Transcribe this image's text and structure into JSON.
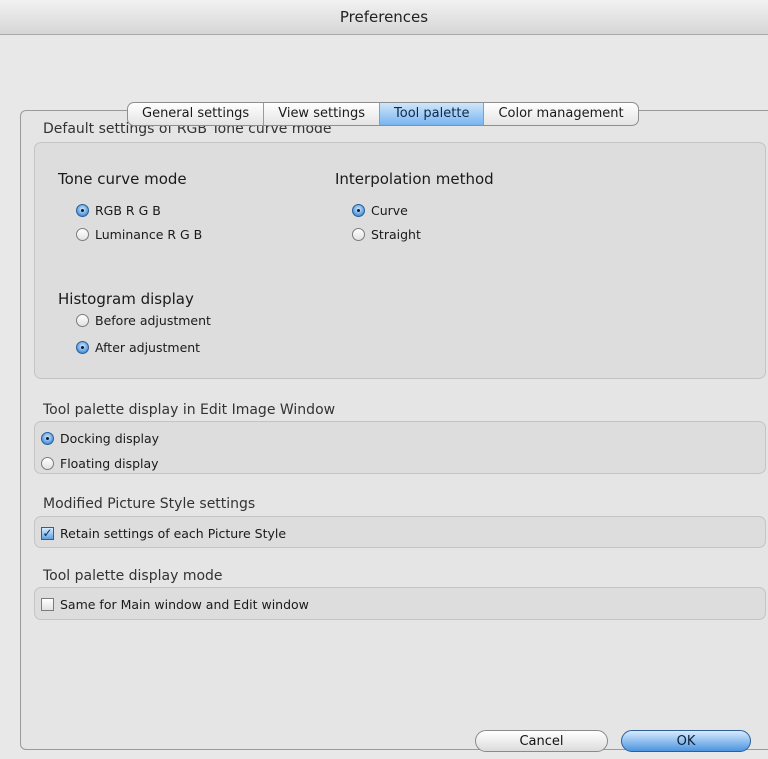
{
  "window": {
    "title": "Preferences"
  },
  "tabs": [
    {
      "label": "General settings",
      "active": false
    },
    {
      "label": "View settings",
      "active": false
    },
    {
      "label": "Tool palette",
      "active": true
    },
    {
      "label": "Color management",
      "active": false
    }
  ],
  "rgb_tone": {
    "title": "Default settings of RGB Tone curve mode",
    "tone_curve_mode": {
      "label": "Tone curve mode",
      "options": [
        {
          "label": "RGB R G B",
          "selected": true
        },
        {
          "label": "Luminance R G B",
          "selected": false
        }
      ]
    },
    "interpolation": {
      "label": "Interpolation method",
      "options": [
        {
          "label": "Curve",
          "selected": true
        },
        {
          "label": "Straight",
          "selected": false
        }
      ]
    },
    "histogram": {
      "label": "Histogram display",
      "options": [
        {
          "label": "Before adjustment",
          "selected": false
        },
        {
          "label": "After adjustment",
          "selected": true
        }
      ]
    }
  },
  "edit_window": {
    "title": "Tool palette display in Edit Image Window",
    "options": [
      {
        "label": "Docking display",
        "selected": true
      },
      {
        "label": "Floating display",
        "selected": false
      }
    ]
  },
  "picture_style": {
    "title": "Modified Picture Style settings",
    "checkbox": {
      "label": "Retain settings of each Picture Style",
      "checked": true
    }
  },
  "display_mode": {
    "title": "Tool palette display mode",
    "checkbox": {
      "label": "Same for Main window and Edit window",
      "checked": false
    }
  },
  "buttons": {
    "cancel": "Cancel",
    "ok": "OK"
  },
  "colors": {
    "accent": "#4d95df",
    "background": "#e8e8e8"
  }
}
